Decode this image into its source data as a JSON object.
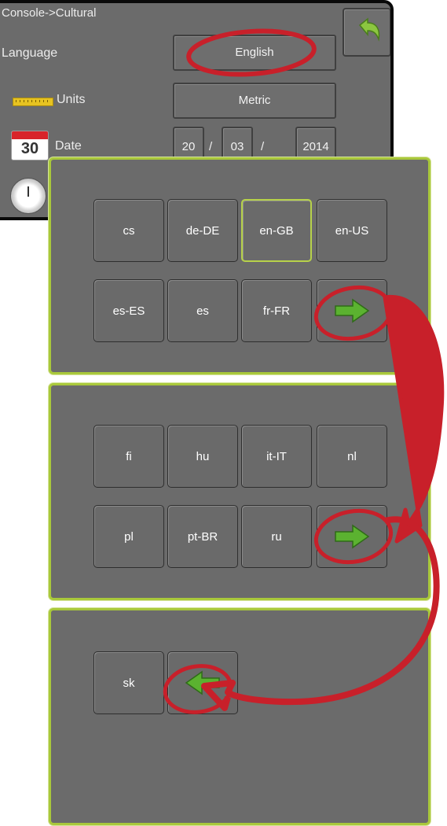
{
  "console": {
    "title": "Console->Cultural",
    "language_label": "Language",
    "language_value": "English",
    "units_label": "Units",
    "units_value": "Metric",
    "date_label": "Date",
    "date_day": "20",
    "date_month": "03",
    "date_year": "2014",
    "date_separator": "/",
    "calendar_number": "30",
    "back_icon": "back-arrow-icon"
  },
  "language_pages": [
    {
      "keys": [
        "cs",
        "de-DE",
        "en-GB",
        "en-US",
        "es-ES",
        "es",
        "fr-FR"
      ],
      "selected": "en-GB",
      "nav": "next-arrow-icon"
    },
    {
      "keys": [
        "fi",
        "hu",
        "it-IT",
        "nl",
        "pl",
        "pt-BR",
        "ru"
      ],
      "nav": "next-arrow-icon"
    },
    {
      "keys": [
        "sk"
      ],
      "nav": "previous-arrow-icon"
    }
  ],
  "colors": {
    "panel_border": "#a9c83b",
    "arrow_green": "#5bb230",
    "annotation_red": "#c8202a",
    "selected_border": "#b7d24a"
  }
}
